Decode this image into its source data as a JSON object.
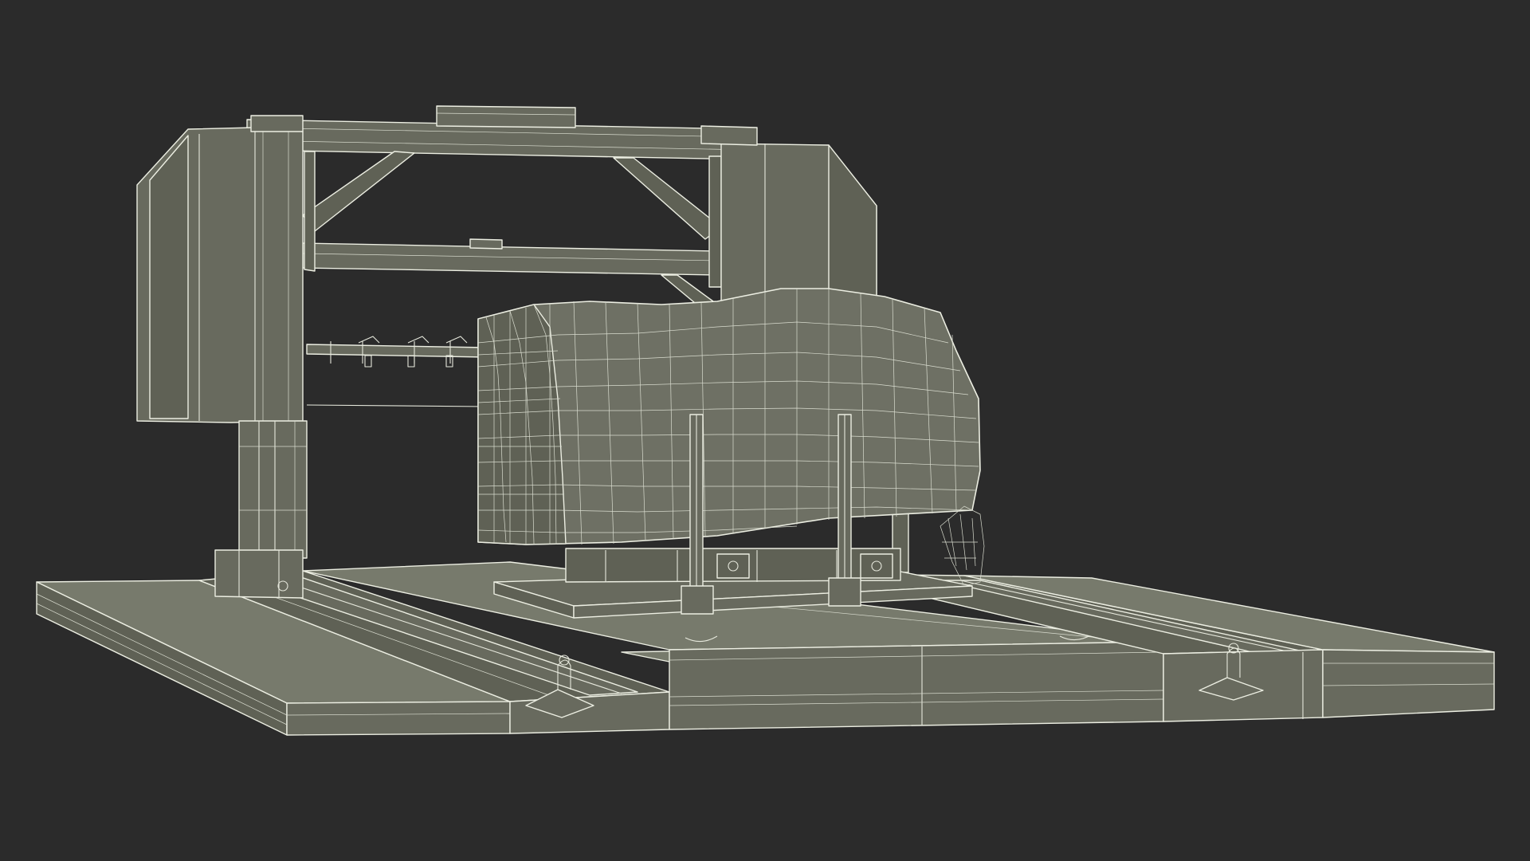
{
  "scene": {
    "background_color": "#2b2b2b",
    "wire_color": "#e6e8dc",
    "surface_color": "#6f7164",
    "subject": "wireframe-render"
  }
}
